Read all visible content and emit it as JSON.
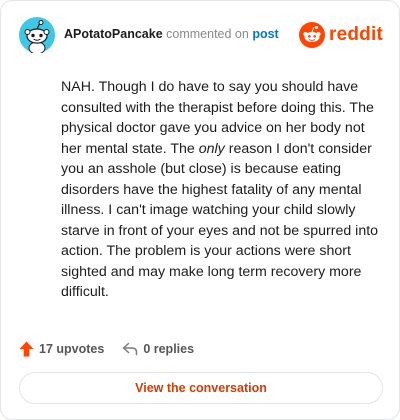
{
  "header": {
    "username": "APotatoPancake",
    "action_text": "commented on",
    "post_link": "post",
    "brand": "reddit"
  },
  "comment": {
    "text_before": "NAH. Though I do have to say you should have consulted with the therapist before doing this. The physical doctor gave you advice on her body not her mental state. The ",
    "emphasis": "only",
    "text_after": " reason I don't consider you an asshole (but close) is because eating disorders have the highest fatality of any mental illness. I can't image watching your child slowly starve in front of your eyes and not be spurred into action. The problem is your actions were short sighted and may make long term recovery more difficult."
  },
  "stats": {
    "upvotes": "17 upvotes",
    "replies": "0 replies"
  },
  "actions": {
    "view_conversation": "View the conversation"
  },
  "colors": {
    "brand": "#ff4500",
    "link": "#0079d3",
    "avatar": "#3ec7e6"
  },
  "icons": {
    "avatar": "snoo-avatar-icon",
    "brand": "reddit-logo-icon",
    "upvote": "upvote-arrow-icon",
    "reply": "reply-arrow-icon"
  }
}
